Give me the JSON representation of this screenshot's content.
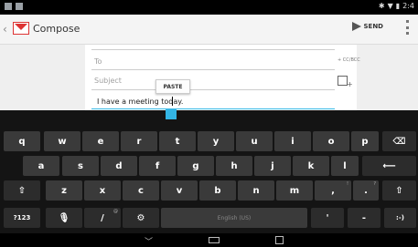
{
  "actionbar": {
    "title": "Compose",
    "send_label": "SEND"
  },
  "compose": {
    "to_placeholder": "To",
    "cc_bcc": "+ CC/BCC",
    "subject_placeholder": "Subject",
    "body": "I have a meeting today.",
    "paste_label": "PASTE"
  },
  "keyboard": {
    "row1": [
      "q",
      "w",
      "e",
      "r",
      "t",
      "y",
      "u",
      "i",
      "o",
      "p"
    ],
    "row2": [
      "a",
      "s",
      "d",
      "f",
      "g",
      "h",
      "j",
      "k",
      "l"
    ],
    "row3": [
      "z",
      "x",
      "c",
      "v",
      "b",
      "n",
      "m",
      ",",
      "."
    ],
    "row3_hints": [
      "!",
      "?"
    ],
    "row4": {
      "symbols": "?123",
      "slash": "/",
      "space": "English (US)",
      "apostrophe": "'",
      "dash": "-",
      "smiley": ":-)"
    }
  },
  "colors": {
    "accent": "#33b5e5",
    "gmail_red": "#d33",
    "key_bg": "#3a3a3a",
    "keyboard_bg": "#141414"
  }
}
